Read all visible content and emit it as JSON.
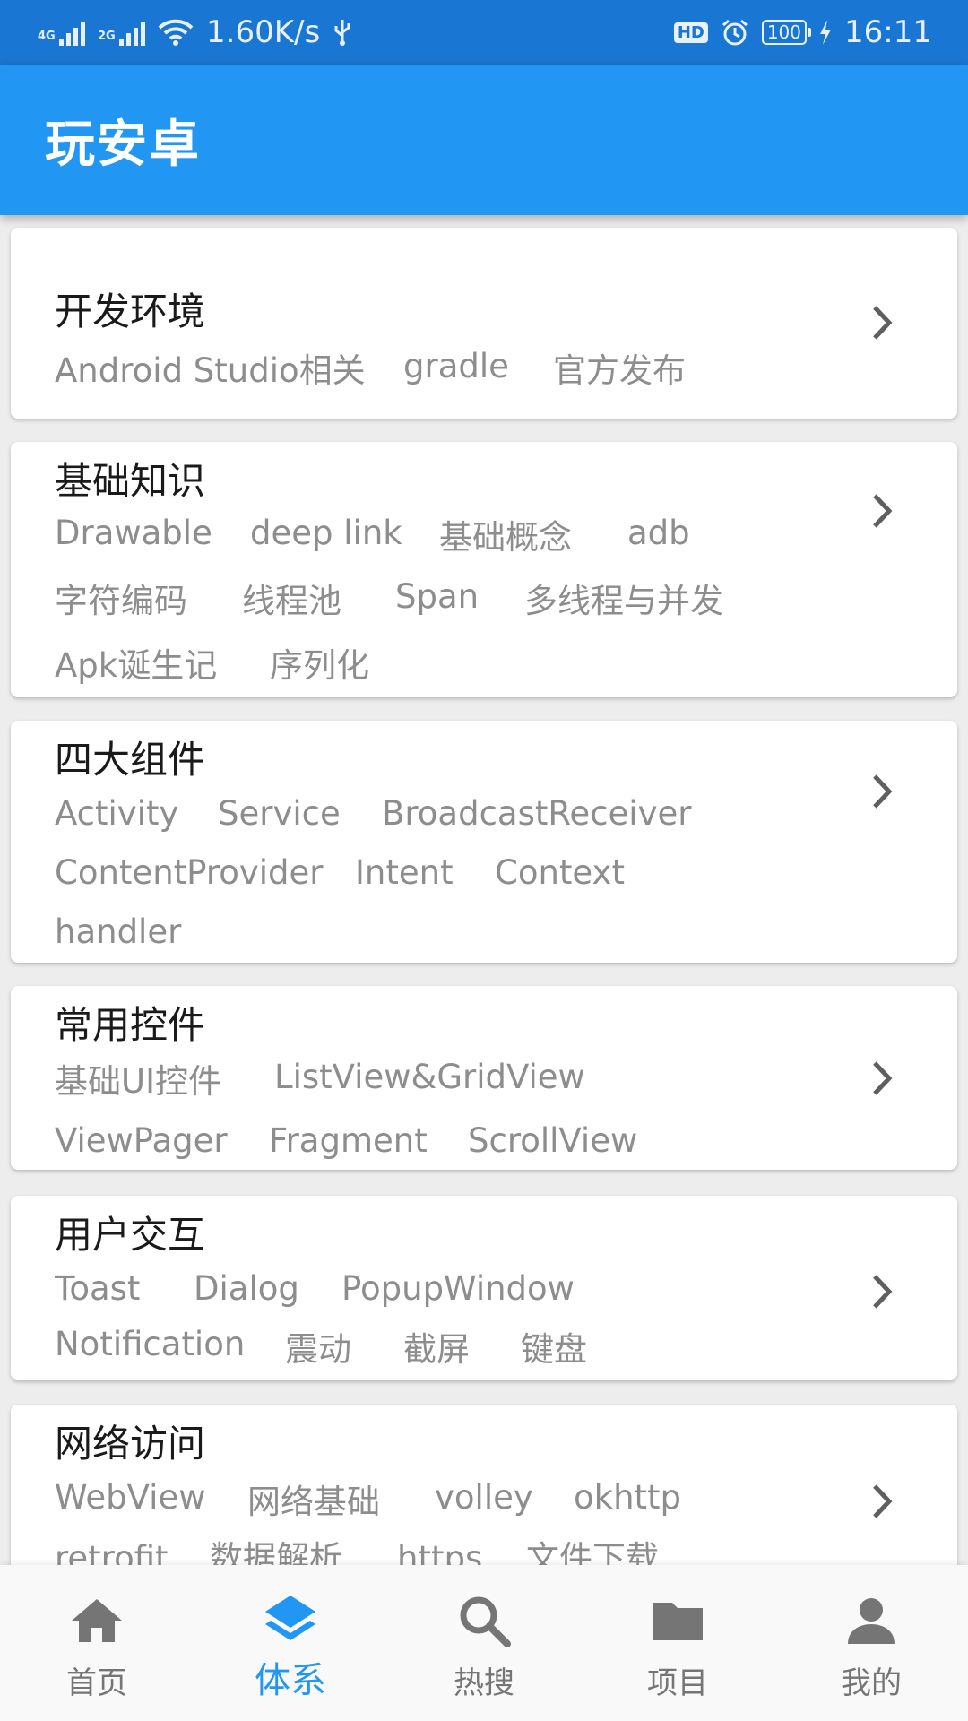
{
  "status_bar": {
    "signal1": "4G",
    "signal2": "2G",
    "speed": "1.60K/s",
    "hd": "HD",
    "battery": "100",
    "time": "16:11"
  },
  "app_bar": {
    "title": "玩安卓"
  },
  "categories": [
    {
      "title": "开发环境",
      "tags": [
        "Android Studio相关",
        "gradle",
        "官方发布"
      ]
    },
    {
      "title": "基础知识",
      "tags": [
        "Drawable",
        "deep link",
        "基础概念",
        "adb",
        "字符编码",
        "线程池",
        "Span",
        "多线程与并发",
        "Apk诞生记",
        "序列化"
      ]
    },
    {
      "title": "四大组件",
      "tags": [
        "Activity",
        "Service",
        "BroadcastReceiver",
        "ContentProvider",
        "Intent",
        "Context",
        "handler"
      ]
    },
    {
      "title": "常用控件",
      "tags": [
        "基础UI控件",
        "ListView&GridView",
        "ViewPager",
        "Fragment",
        "ScrollView"
      ]
    },
    {
      "title": "用户交互",
      "tags": [
        "Toast",
        "Dialog",
        "PopupWindow",
        "Notification",
        "震动",
        "截屏",
        "键盘"
      ]
    },
    {
      "title": "网络访问",
      "tags": [
        "WebView",
        "网络基础",
        "volley",
        "okhttp",
        "retrofit",
        "数据解析",
        "https",
        "文件下载"
      ]
    }
  ],
  "bottom_nav": {
    "selected": "体系",
    "items": [
      {
        "label": "首页",
        "icon": "home-icon"
      },
      {
        "label": "体系",
        "icon": "layers-icon"
      },
      {
        "label": "热搜",
        "icon": "search-icon"
      },
      {
        "label": "项目",
        "icon": "folder-icon"
      },
      {
        "label": "我的",
        "icon": "person-icon"
      }
    ]
  },
  "colors": {
    "status_bar": "#1976d2",
    "app_bar": "#2196f3",
    "accent": "#2196f3",
    "tag_text": "#8d8d8d",
    "nav_inactive": "#757575"
  }
}
